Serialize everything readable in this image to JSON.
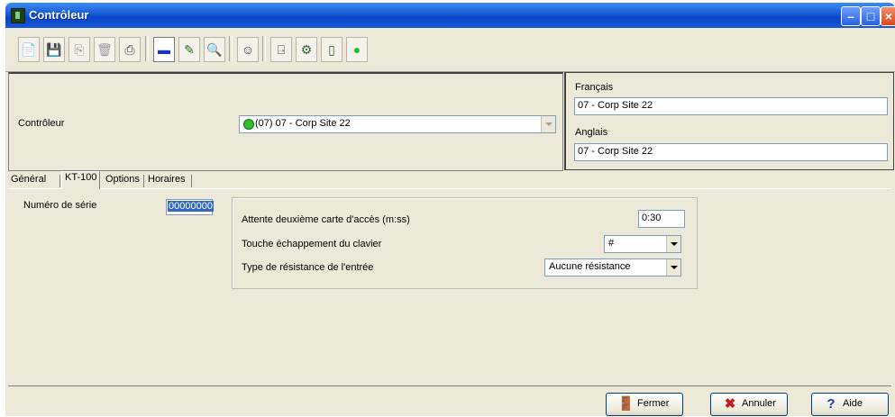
{
  "window": {
    "title": "Contrôleur"
  },
  "toolbar": {
    "tools": [
      {
        "icon": "new-icon",
        "glyph": "📄",
        "color": "#9a9a9a",
        "state": "disabled"
      },
      {
        "icon": "save-icon",
        "glyph": "💾",
        "color": "#8b0000",
        "state": "enabled"
      },
      {
        "icon": "copy-icon",
        "glyph": "⎘",
        "color": "#9a9a9a",
        "state": "disabled"
      },
      {
        "icon": "delete-icon",
        "glyph": "🗑",
        "color": "#9a9a9a",
        "state": "disabled"
      },
      {
        "icon": "print-icon",
        "glyph": "⎙",
        "color": "#404040",
        "state": "enabled"
      },
      {
        "icon": "minimize-view-icon",
        "glyph": "▬",
        "color": "#1a33c8",
        "state": "pressed"
      },
      {
        "icon": "edit-pen-icon",
        "glyph": "✎",
        "color": "#207020",
        "state": "enabled"
      },
      {
        "icon": "find-icon",
        "glyph": "🔍",
        "color": "#9a9a9a",
        "state": "disabled"
      },
      {
        "icon": "operator-icon",
        "glyph": "☺",
        "color": "#404040",
        "state": "enabled"
      },
      {
        "icon": "door-icon",
        "glyph": "⍈",
        "color": "#404040",
        "state": "enabled"
      },
      {
        "icon": "reader-icon",
        "glyph": "⚙",
        "color": "#306030",
        "state": "enabled"
      },
      {
        "icon": "controller-icon",
        "glyph": "▯",
        "color": "#2a6a2a",
        "state": "enabled"
      },
      {
        "icon": "status-green-icon",
        "glyph": "●",
        "color": "#22c022",
        "state": "enabled"
      }
    ]
  },
  "header": {
    "controller_label": "Contrôleur",
    "controller_value": "(07) 07 - Corp Site 22",
    "lang1_label": "Français",
    "lang1_value": "07 - Corp Site 22",
    "lang2_label": "Anglais",
    "lang2_value": "07 - Corp Site 22"
  },
  "tabs": [
    "Général",
    "KT-100",
    "Options",
    "Horaires"
  ],
  "active_tab": "KT-100",
  "kt100": {
    "serial_label": "Numéro de série",
    "serial_value": "00000000",
    "second_card_label": "Attente deuxième carte d'accès (m:ss)",
    "second_card_value": "0:30",
    "escape_key_label": "Touche échappement du clavier",
    "escape_key_value": "#",
    "resistance_label": "Type de résistance de l'entrée",
    "resistance_value": "Aucune résistance"
  },
  "footer": {
    "close_label": "Fermer",
    "cancel_label": "Annuler",
    "help_label": "Aide"
  }
}
